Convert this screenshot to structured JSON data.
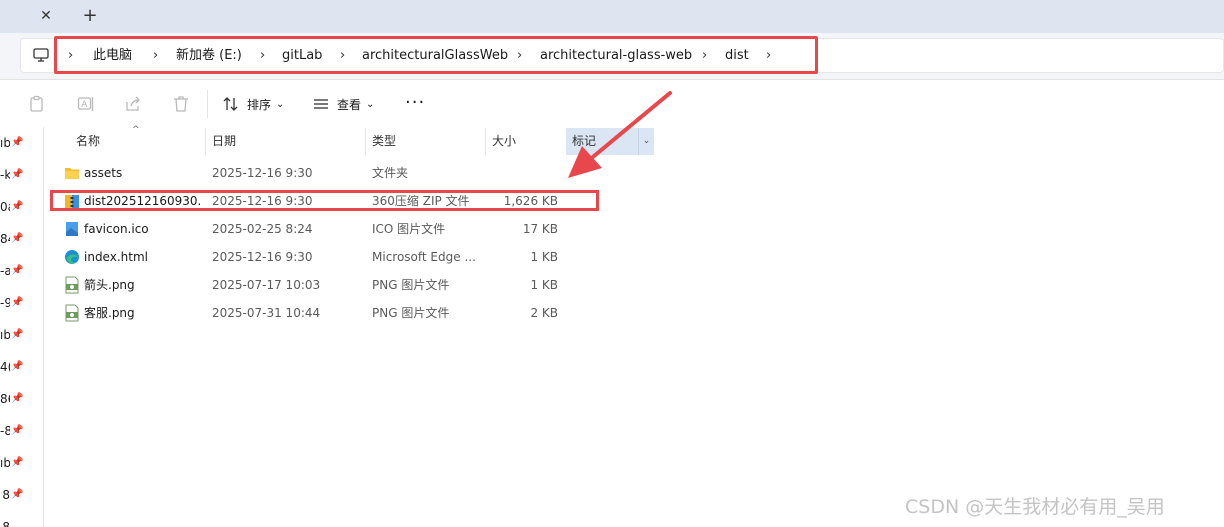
{
  "tabs": {
    "close_glyph": "✕",
    "new_glyph": "+"
  },
  "breadcrumb": {
    "items": [
      "此电脑",
      "新加卷 (E:)",
      "gitLab",
      "architecturalGlassWeb",
      "architectural-glass-web",
      "dist"
    ],
    "separator": "›"
  },
  "toolbar": {
    "sort_label": "排序",
    "view_label": "查看",
    "more_label": "···",
    "caret": "⌄"
  },
  "nav": {
    "items": [
      "ıb",
      "-k",
      "0a",
      "84",
      "-a",
      "-9",
      "ıb",
      "4(",
      "86",
      "-8",
      "ıb",
      "8",
      "8"
    ],
    "pin": "📌"
  },
  "columns": {
    "name": "名称",
    "date": "日期",
    "type": "类型",
    "size": "大小",
    "tags": "标记",
    "sort_caret": "^"
  },
  "files": [
    {
      "name": "assets",
      "date": "2025-12-16 9:30",
      "type": "文件夹",
      "size": "",
      "icon": "folder-icon"
    },
    {
      "name": "dist202512160930...",
      "date": "2025-12-16 9:30",
      "type": "360压缩 ZIP 文件",
      "size": "1,626 KB",
      "icon": "zip-archive-icon"
    },
    {
      "name": "favicon.ico",
      "date": "2025-02-25 8:24",
      "type": "ICO 图片文件",
      "size": "17 KB",
      "icon": "ico-image-icon"
    },
    {
      "name": "index.html",
      "date": "2025-12-16 9:30",
      "type": "Microsoft Edge ...",
      "size": "1 KB",
      "icon": "edge-html-icon"
    },
    {
      "name": "箭头.png",
      "date": "2025-07-17 10:03",
      "type": "PNG 图片文件",
      "size": "1 KB",
      "icon": "png-image-icon"
    },
    {
      "name": "客服.png",
      "date": "2025-07-31 10:44",
      "type": "PNG 图片文件",
      "size": "2 KB",
      "icon": "png-image-icon"
    }
  ],
  "annotation_color": "#e8474b",
  "watermark": "CSDN @天生我材必有用_吴用"
}
